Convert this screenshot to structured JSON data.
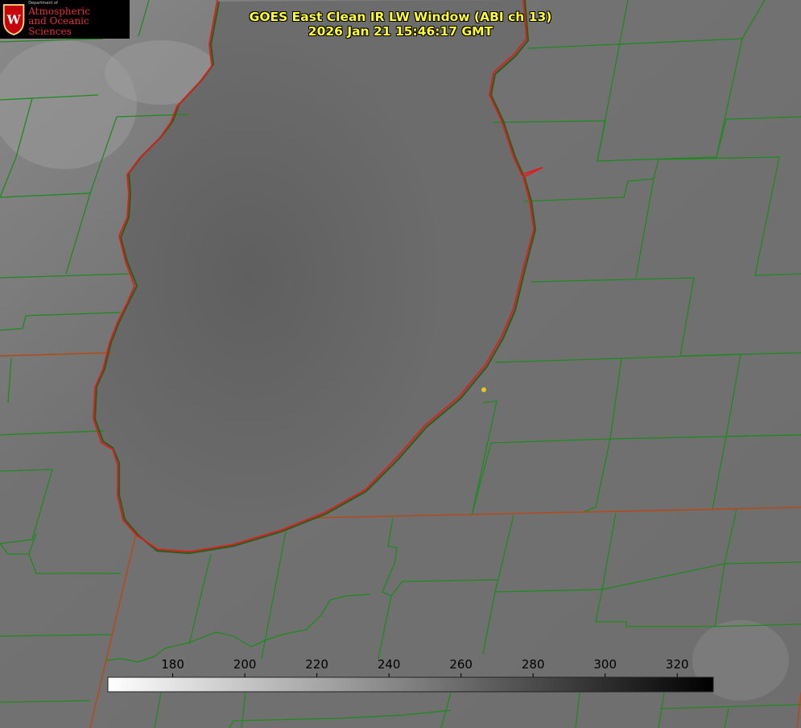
{
  "branding": {
    "dept_line": "Department of",
    "name_line1": "Atmospheric",
    "name_line2": "and Oceanic Sciences"
  },
  "title": {
    "line1": "GOES East Clean IR LW Window (ABI ch 13)",
    "line2": "2026 Jan 21 15:46:17 GMT"
  },
  "colorbar": {
    "ticks": [
      "180",
      "200",
      "220",
      "240",
      "260",
      "280",
      "300",
      "320"
    ],
    "min": 162,
    "max": 330,
    "gradient": [
      "#ffffff",
      "#000000"
    ]
  },
  "colors": {
    "lake_outline": "#e21b1b",
    "borders": "#1e8a1e",
    "marker": "#e6c81e",
    "title": "#ffff33"
  }
}
